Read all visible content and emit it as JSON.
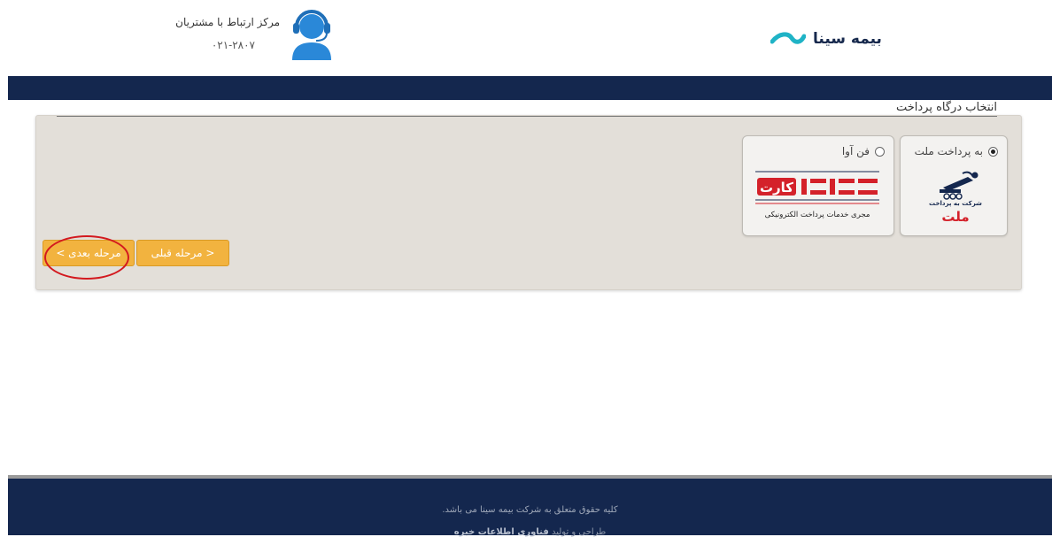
{
  "header": {
    "brand_name": "بیمه سینا",
    "support_title": "مرکز ارتباط با مشتریان",
    "support_phone": "۰۲۱-۲۸۰۷"
  },
  "section": {
    "title": "انتخاب درگاه پرداخت"
  },
  "gateways": [
    {
      "label": "به پرداخت ملت",
      "selected": true,
      "logo_text_line1": "شرکت به پرداخت",
      "logo_text_line2": "ملت"
    },
    {
      "label": "فن آوا",
      "selected": false,
      "logo_text_main": "فن آوا کارت",
      "logo_text_sub": "مجری خدمات پرداخت الکترونیکی"
    }
  ],
  "buttons": {
    "prev_label": "< مرحله قبلی",
    "next_label": "مرحله بعدی >"
  },
  "footer": {
    "copyright": "کلیه حقوق متعلق به شرکت بیمه سینا می باشد.",
    "design_prefix": "طراحی و تولید",
    "design_company": "فناوری اطلاعات خبره"
  },
  "colors": {
    "navy": "#14274e",
    "accent_orange": "#f2b33f",
    "panel_bg": "#e3dfd9",
    "mellat_red": "#d4212a",
    "brand_teal": "#1fb3c6",
    "annotation_red": "#d3191f"
  }
}
